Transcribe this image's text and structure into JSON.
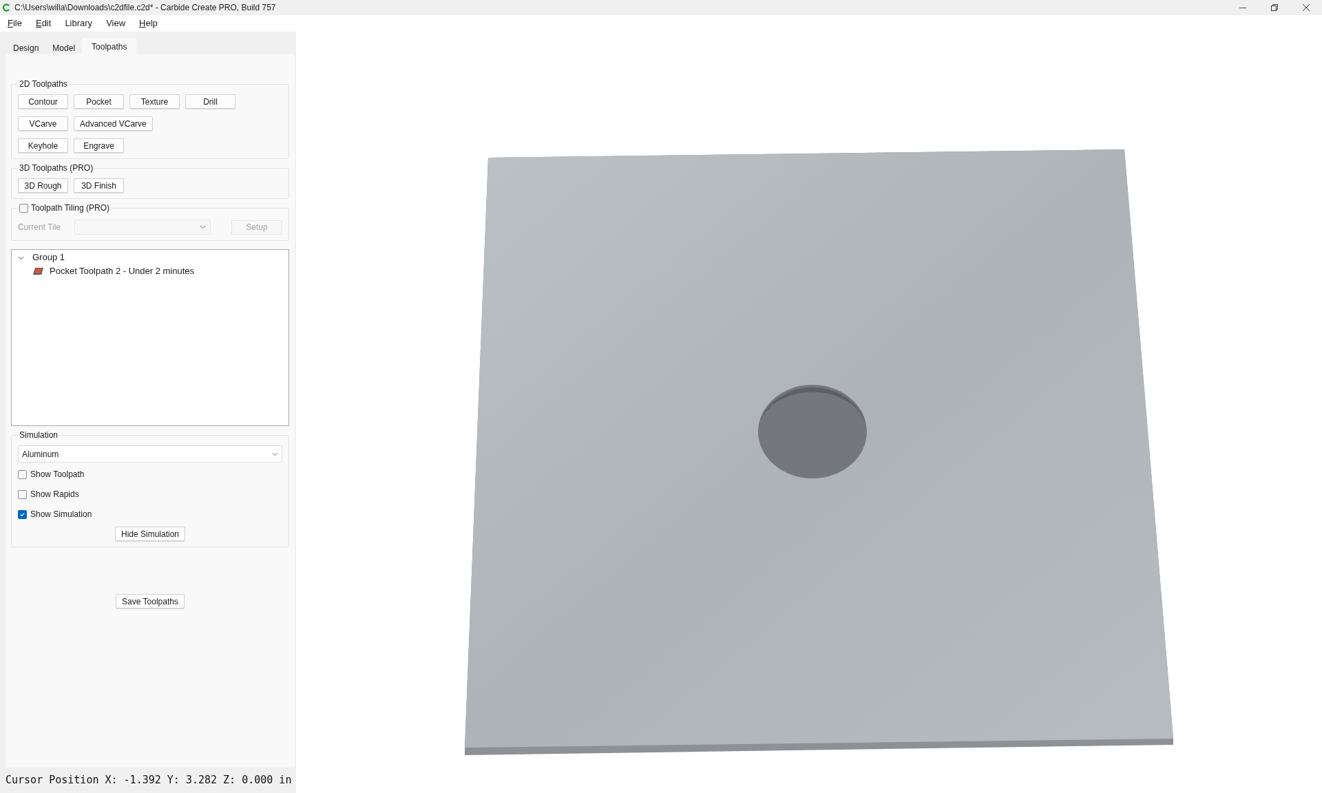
{
  "window": {
    "title": "C:\\Users\\willa\\Downloads\\c2dfile.c2d* - Carbide Create PRO, Build 757"
  },
  "menu": [
    {
      "label": "File",
      "underlined": true
    },
    {
      "label": "Edit",
      "underlined": true
    },
    {
      "label": "Library",
      "underlined": false
    },
    {
      "label": "View",
      "underlined": false
    },
    {
      "label": "Help",
      "underlined": true
    }
  ],
  "tabs": [
    {
      "label": "Design",
      "selected": false
    },
    {
      "label": "Model",
      "selected": false
    },
    {
      "label": "Toolpaths",
      "selected": true
    }
  ],
  "toolpaths_2d": {
    "title": "2D Toolpaths",
    "rows": [
      [
        "Contour",
        "Pocket",
        "Texture",
        "Drill"
      ],
      [
        "VCarve",
        "Advanced VCarve"
      ],
      [
        "Keyhole",
        "Engrave"
      ]
    ]
  },
  "toolpaths_3d": {
    "title": "3D Toolpaths (PRO)",
    "buttons": [
      "3D Rough",
      "3D Finish"
    ]
  },
  "tiling": {
    "label": "Toolpath Tiling (PRO)",
    "checked": false,
    "current_tile_label": "Current Tile",
    "setup_button": "Setup"
  },
  "tree": [
    {
      "label": "Group 1",
      "expanded": true,
      "children": [
        {
          "label": "Pocket Toolpath 2 - Under 2 minutes"
        }
      ]
    }
  ],
  "simulation": {
    "title": "Simulation",
    "material": "Aluminum",
    "options": [
      {
        "label": "Show Toolpath",
        "checked": false
      },
      {
        "label": "Show Rapids",
        "checked": false
      },
      {
        "label": "Show Simulation",
        "checked": true
      }
    ],
    "button": "Hide Simulation"
  },
  "save_button": "Save Toolpaths",
  "status_bar": "Cursor Position X: -1.392 Y: 3.282 Z: 0.000 in"
}
